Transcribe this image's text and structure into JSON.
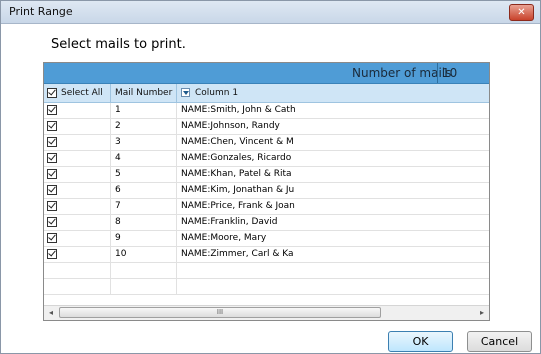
{
  "window": {
    "title": "Print Range",
    "close_glyph": "✕"
  },
  "instruction": "Select mails to print.",
  "summary": {
    "label": "Number of mails",
    "value": "10"
  },
  "table": {
    "headers": {
      "select": "Select All",
      "number": "Mail Number",
      "column": "Column 1"
    },
    "rows": [
      {
        "checked": true,
        "number": "1",
        "column": "NAME:Smith, John & Cath"
      },
      {
        "checked": true,
        "number": "2",
        "column": "NAME:Johnson, Randy"
      },
      {
        "checked": true,
        "number": "3",
        "column": "NAME:Chen, Vincent & M"
      },
      {
        "checked": true,
        "number": "4",
        "column": "NAME:Gonzales, Ricardo"
      },
      {
        "checked": true,
        "number": "5",
        "column": "NAME:Khan, Patel & Rita"
      },
      {
        "checked": true,
        "number": "6",
        "column": "NAME:Kim, Jonathan & Ju"
      },
      {
        "checked": true,
        "number": "7",
        "column": "NAME:Price, Frank & Joan"
      },
      {
        "checked": true,
        "number": "8",
        "column": "NAME:Franklin, David"
      },
      {
        "checked": true,
        "number": "9",
        "column": "NAME:Moore, Mary"
      },
      {
        "checked": true,
        "number": "10",
        "column": "NAME:Zimmer, Carl & Ka"
      }
    ],
    "empty_rows": 2
  },
  "scrollbar": {
    "left_arrow": "◂",
    "right_arrow": "▸",
    "thumb_grip": "III"
  },
  "buttons": {
    "ok": "OK",
    "cancel": "Cancel"
  },
  "colors": {
    "summary_bar": "#4f9cd6",
    "header_row": "#cfe5f6"
  }
}
